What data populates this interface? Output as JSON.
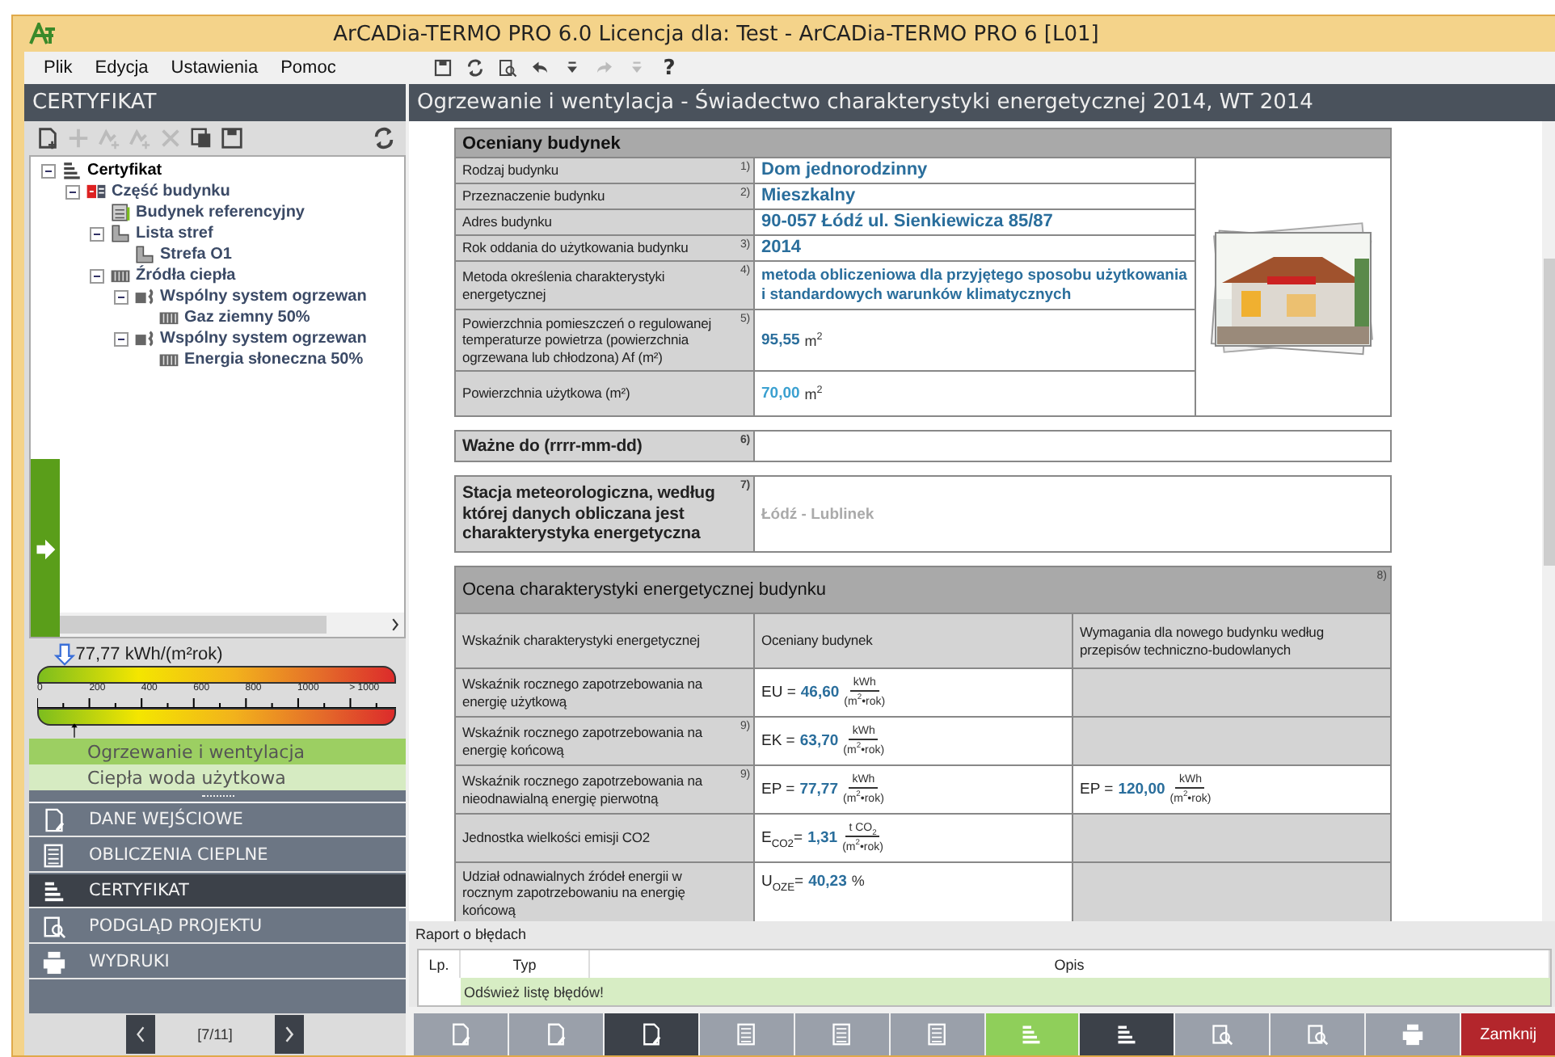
{
  "window": {
    "title": "ArCADia-TERMO PRO 6.0 Licencja dla: Test - ArCADia-TERMO PRO 6 [L01]"
  },
  "menu": [
    {
      "label": "Plik"
    },
    {
      "label": "Edycja"
    },
    {
      "label": "Ustawienia"
    },
    {
      "label": "Pomoc"
    }
  ],
  "toolbar": [
    {
      "kind": "save",
      "disabled": false
    },
    {
      "kind": "refresh",
      "disabled": false
    },
    {
      "kind": "preview",
      "disabled": false
    },
    {
      "kind": "undo",
      "disabled": false
    },
    {
      "kind": "dropdown",
      "disabled": false
    },
    {
      "kind": "redo",
      "disabled": true
    },
    {
      "kind": "dropdown",
      "disabled": true
    },
    {
      "kind": "help",
      "label": "?",
      "disabled": false
    }
  ],
  "left_panel": {
    "title": "CERTYFIKAT",
    "tree_toolbar": [
      {
        "kind": "new",
        "disabled": false
      },
      {
        "kind": "add",
        "disabled": true
      },
      {
        "kind": "branch",
        "disabled": true
      },
      {
        "kind": "branch",
        "disabled": true
      },
      {
        "kind": "delete",
        "disabled": true
      },
      {
        "kind": "copy",
        "disabled": false
      },
      {
        "kind": "save",
        "disabled": false
      },
      {
        "kind": "refresh",
        "disabled": false
      }
    ],
    "tree": [
      {
        "label": "Certyfikat",
        "kind": "certificate",
        "expanded": true,
        "children": [
          {
            "label": "Część budynku",
            "kind": "part",
            "expanded": true,
            "children": [
              {
                "label": "Budynek referencyjny",
                "kind": "building"
              },
              {
                "label": "Lista stref",
                "kind": "zones",
                "expanded": true,
                "children": [
                  {
                    "label": "Strefa O1",
                    "kind": "zone"
                  }
                ]
              },
              {
                "label": "Źródła ciepła",
                "kind": "heat",
                "expanded": true,
                "children": [
                  {
                    "label": "Wspólny system ogrzewan",
                    "kind": "system",
                    "expanded": true,
                    "children": [
                      {
                        "label": "Gaz ziemny 50%",
                        "kind": "source"
                      }
                    ]
                  },
                  {
                    "label": "Wspólny system ogrzewan",
                    "kind": "system",
                    "expanded": true,
                    "children": [
                      {
                        "label": "Energia słoneczna 50%",
                        "kind": "source"
                      }
                    ]
                  }
                ]
              }
            ]
          }
        ]
      }
    ],
    "energy_scale": {
      "reading": "77,77 kWh/(m²rok)",
      "level": 0.08,
      "ticks": [
        "0",
        "200",
        "400",
        "600",
        "800",
        "1000",
        "> 1000"
      ],
      "reference": {
        "level": 0.12
      }
    },
    "nav_items": [
      {
        "label": "Ogrzewanie i wentylacja",
        "selected": true
      },
      {
        "label": "Ciepła woda użytkowa",
        "selected": false
      }
    ],
    "modules": [
      {
        "label": "DANE WEJŚCIOWE",
        "kind": "input",
        "selected": false
      },
      {
        "label": "OBLICZENIA CIEPLNE",
        "kind": "calc",
        "selected": false
      },
      {
        "label": "CERTYFIKAT",
        "kind": "cert",
        "selected": true
      },
      {
        "label": "PODGLĄD PROJEKTU",
        "kind": "preview",
        "selected": false
      },
      {
        "label": "WYDRUKI",
        "kind": "print",
        "selected": false
      }
    ],
    "pager": {
      "page": "[7/11]"
    }
  },
  "content": {
    "title": "Ogrzewanie i wentylacja - Świadectwo charakterystyki energetycznej 2014, WT 2014",
    "building": {
      "title": "Oceniany budynek",
      "rows": [
        {
          "label": "Rodzaj budynku",
          "note": "1)",
          "value": "Dom jednorodzinny",
          "kind": "title"
        },
        {
          "label": "Przeznaczenie budynku",
          "note": "2)",
          "value": "Mieszkalny",
          "kind": "title"
        },
        {
          "label": "Adres budynku",
          "value": "90-057 Łódź ul. Sienkiewicza 85/87",
          "kind": "title"
        },
        {
          "label": "Rok oddania do użytkowania budynku",
          "note": "3)",
          "value": "2014",
          "kind": "title"
        },
        {
          "label": "Metoda określenia charakterystyki energetycznej",
          "note": "4)",
          "value": "metoda obliczeniowa dla przyjętego sposobu użytkowania i standardowych warunków klimatycznych",
          "kind": "text"
        },
        {
          "label": "Powierzchnia pomieszczeń o regulowanej temperaturze powietrza (powierzchnia ogrzewana lub chłodzona) Af (m²)",
          "note": "5)",
          "value": "95,55",
          "unit": "m$^{2}$",
          "kind": "area"
        },
        {
          "label": "Powierzchnia użytkowa (m²)",
          "value": "70,00",
          "unit": "m$^{2}$",
          "kind": "area-light"
        }
      ]
    },
    "valid_until": {
      "label": "Ważne do (rrrr-mm-dd)",
      "note": "6)"
    },
    "station": {
      "label": "Stacja meteorologiczna, według której danych obliczana jest charakterystyka energetyczna",
      "note": "7)",
      "value": "Łódź - Lublinek"
    },
    "assessment": {
      "title": "Ocena charakterystyki energetycznej budynku",
      "note": "8)",
      "columns": [
        "Wskaźnik charakterystyki energetycznej",
        "Oceniany budynek",
        "Wymagania dla nowego budynku według przepisów techniczno-budowlanych"
      ],
      "rows": [
        {
          "label": "Wskaźnik rocznego zapotrzebowania na energię użytkową",
          "kind": "fraction",
          "symbol": "EU =",
          "value": "46,60",
          "num": "kWh",
          "den": "(m$^{2}$•rok)"
        },
        {
          "label": "Wskaźnik rocznego zapotrzebowania na energię końcową",
          "note": "9)",
          "kind": "fraction",
          "symbol": "EK =",
          "value": "63,70",
          "num": "kWh",
          "den": "(m$^{2}$•rok)"
        },
        {
          "label": "Wskaźnik rocznego zapotrzebowania na nieodnawialną energię pierwotną",
          "note": "9)",
          "kind": "fraction",
          "symbol": "EP =",
          "value": "77,77",
          "num": "kWh",
          "den": "(m$^{2}$•rok)",
          "requirement": {
            "symbol": "EP =",
            "value": "120,00",
            "num": "kWh",
            "den": "(m$^{2}$•rok)"
          }
        },
        {
          "label": "Jednostka wielkości emisji CO2",
          "kind": "fraction",
          "symbol": "E$_{CO2}$=",
          "value": "1,31",
          "num": "t CO$_{2}$",
          "den": "(m$^{2}$•rok)"
        },
        {
          "label": "Udział odnawialnych źródeł energii w rocznym zapotrzebowaniu na energię końcową",
          "kind": "percent",
          "symbol": "U$_{OZE}$=",
          "value": "40,23",
          "unit": "%"
        }
      ]
    },
    "error_report": {
      "title": "Raport o błędach",
      "columns": [
        "Lp.",
        "Typ",
        "Opis"
      ],
      "message": "Odśwież listę błędów!"
    },
    "bottom_toolbar": [
      {
        "kind": "input",
        "color": "#9aa0aa"
      },
      {
        "kind": "input",
        "color": "#9aa0aa"
      },
      {
        "kind": "input",
        "color": "#3c4149"
      },
      {
        "kind": "calc",
        "color": "#9aa0aa"
      },
      {
        "kind": "calc",
        "color": "#9aa0aa"
      },
      {
        "kind": "calc",
        "color": "#9aa0aa"
      },
      {
        "kind": "cert",
        "color": "#8fcf5a"
      },
      {
        "kind": "cert",
        "color": "#3c4149"
      },
      {
        "kind": "preview",
        "color": "#9aa0aa"
      },
      {
        "kind": "preview",
        "color": "#9aa0aa"
      },
      {
        "kind": "print",
        "color": "#9aa0aa"
      },
      {
        "label": "Zamknij",
        "color": "#b3262c"
      }
    ]
  }
}
